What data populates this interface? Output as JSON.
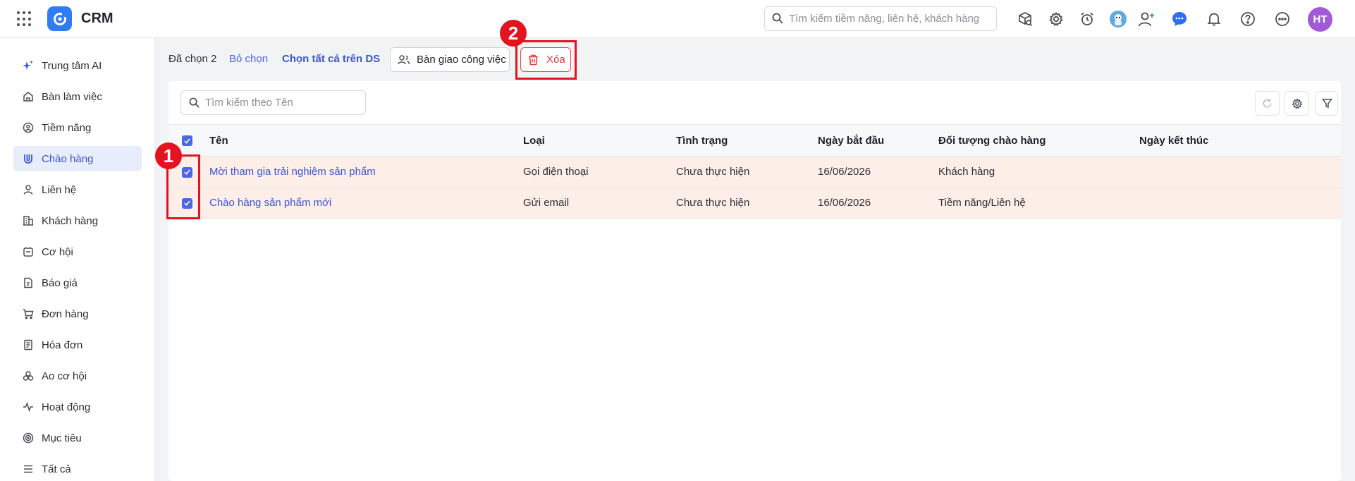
{
  "header": {
    "app_name": "CRM",
    "search_placeholder": "Tìm kiếm tiềm năng, liên hệ, khách hàng",
    "user_initials": "HT"
  },
  "sidebar": {
    "items": [
      {
        "label": "Trung tâm AI",
        "icon": "sparkle-icon"
      },
      {
        "label": "Bàn làm việc",
        "icon": "home-icon"
      },
      {
        "label": "Tiềm năng",
        "icon": "lead-icon"
      },
      {
        "label": "Chào hàng",
        "icon": "magnet-icon",
        "active": true
      },
      {
        "label": "Liên hệ",
        "icon": "contact-icon"
      },
      {
        "label": "Khách hàng",
        "icon": "building-icon"
      },
      {
        "label": "Cơ hội",
        "icon": "opportunity-icon"
      },
      {
        "label": "Báo giá",
        "icon": "quote-icon"
      },
      {
        "label": "Đơn hàng",
        "icon": "cart-icon"
      },
      {
        "label": "Hóa đơn",
        "icon": "invoice-icon"
      },
      {
        "label": "Ao cơ hội",
        "icon": "pool-icon"
      },
      {
        "label": "Hoạt động",
        "icon": "activity-icon"
      },
      {
        "label": "Mục tiêu",
        "icon": "target-icon"
      },
      {
        "label": "Tất cả",
        "icon": "menu-icon"
      }
    ]
  },
  "toolbar": {
    "selected_count": "Đã chọn 2",
    "deselect": "Bỏ chọn",
    "select_all": "Chọn tất cả trên DS",
    "assign_label": "Bàn giao công việc",
    "delete_label": "Xóa"
  },
  "annotations": {
    "badge1": "1",
    "badge2": "2",
    "color": "#e3131f"
  },
  "list": {
    "search_placeholder": "Tìm kiếm theo Tên",
    "columns": [
      "Tên",
      "Loại",
      "Tình trạng",
      "Ngày bắt đầu",
      "Đối tượng chào hàng",
      "Ngày kết thúc"
    ],
    "rows": [
      {
        "checked": true,
        "name": "Mời tham gia trải nghiệm sản phẩm",
        "type": "Gọi điện thoại",
        "status": "Chưa thực hiện",
        "start": "16/06/2026",
        "target": "Khách hàng",
        "end": ""
      },
      {
        "checked": true,
        "name": "Chào hàng sản phẩm mới",
        "type": "Gửi email",
        "status": "Chưa thực hiện",
        "start": "16/06/2026",
        "target": "Tiềm năng/Liên hệ",
        "end": ""
      }
    ]
  },
  "colors": {
    "accent": "#3b54d9",
    "selected_row": "#fdeee8",
    "delete": "#e03c3c"
  }
}
